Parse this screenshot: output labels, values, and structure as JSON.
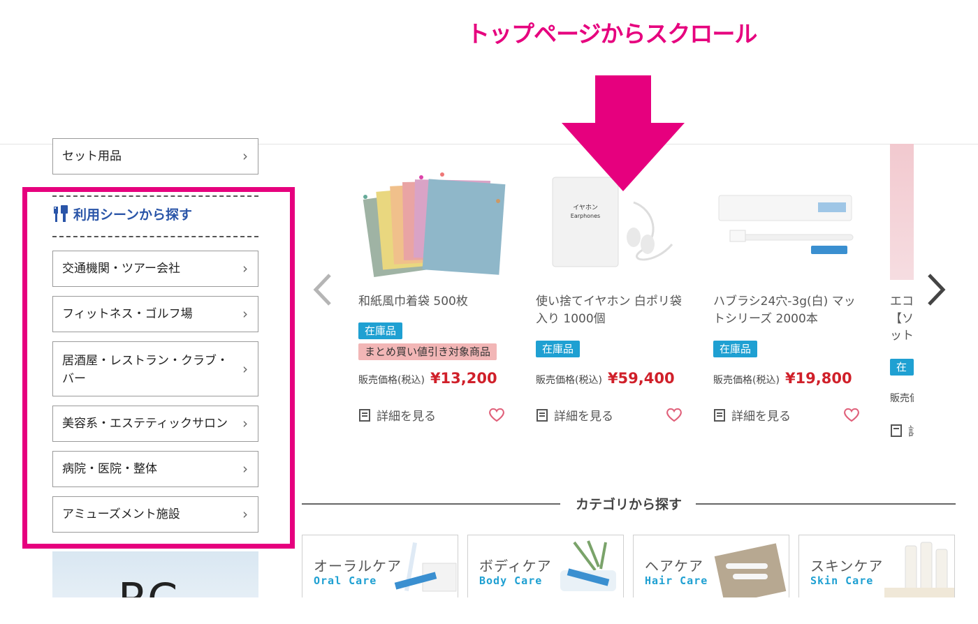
{
  "annotation": {
    "title": "トップページからスクロール",
    "arrow_color": "#e6007e"
  },
  "sidebar": {
    "top_item": "セット用品",
    "scene_heading": "利用シーンから探す",
    "scene_items": [
      "交通機関・ツアー会社",
      "フィットネス・ゴルフ場",
      "居酒屋・レストラン・クラブ・バー",
      "美容系・エステティックサロン",
      "病院・医院・整体",
      "アミューズメント施設"
    ],
    "banner_text": "RC",
    "highlight_color": "#e6007e"
  },
  "products": [
    {
      "name": "和紙風巾着袋 500枚",
      "stock": "在庫品",
      "sale": "まとめ買い値引き対象商品",
      "price_label": "販売価格(税込)",
      "price": "¥13,200",
      "detail": "詳細を見る"
    },
    {
      "name": "使い捨てイヤホン 白ポリ袋入り 1000個",
      "stock": "在庫品",
      "price_label": "販売価格(税込)",
      "price": "¥59,400",
      "detail": "詳細を見る",
      "package_text": "イヤホン Earphones"
    },
    {
      "name": "ハブラシ24穴-3g(白) マットシリーズ 2000本",
      "stock": "在庫品",
      "price_label": "販売価格(税込)",
      "price": "¥19,800",
      "detail": "詳細を見る"
    }
  ],
  "partial_product": {
    "name_line1": "エコ",
    "name_line2": "【ソ",
    "name_line3": "ット",
    "stock": "在庫",
    "price_label": "販売価",
    "detail": "詳"
  },
  "categories": {
    "title": "カテゴリから探す",
    "items": [
      {
        "jp": "オーラルケア",
        "en": "Oral Care"
      },
      {
        "jp": "ボディケア",
        "en": "Body Care"
      },
      {
        "jp": "ヘアケア",
        "en": "Hair Care"
      },
      {
        "jp": "スキンケア",
        "en": "Skin Care"
      }
    ]
  },
  "colors": {
    "accent_pink": "#e6007e",
    "stock_blue": "#1fa0d2",
    "price_red": "#d0202a",
    "heading_blue": "#2a55a8"
  }
}
